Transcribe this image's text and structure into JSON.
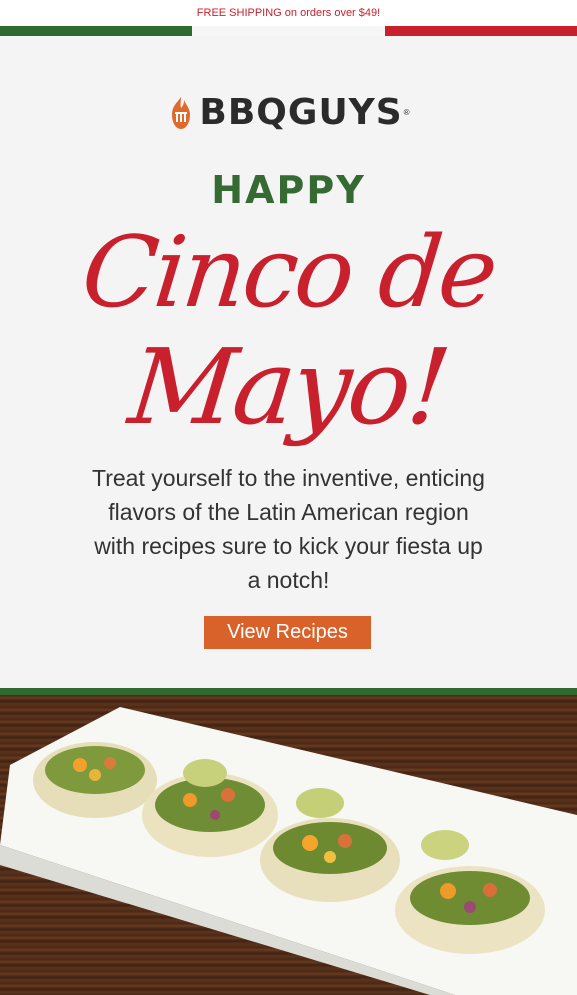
{
  "topbar": {
    "text": "FREE SHIPPING on orders over $49!"
  },
  "brand": {
    "logo_text": "BBQGUYS",
    "registered": "®",
    "icon": "grill-flame-icon"
  },
  "hero": {
    "eyebrow": "HAPPY",
    "title_line1": "Cinco de",
    "title_line2": "Mayo!",
    "body": "Treat yourself to the inventive, enticing flavors of the Latin American region with recipes sure to kick your fiesta up a notch!",
    "cta_label": "View Recipes"
  },
  "colors": {
    "green": "#2f6a2f",
    "red": "#c8202d",
    "cta": "#d9622b",
    "hero_bg": "#f4f4f4"
  },
  "image": {
    "subject": "tacos-on-white-platter"
  }
}
